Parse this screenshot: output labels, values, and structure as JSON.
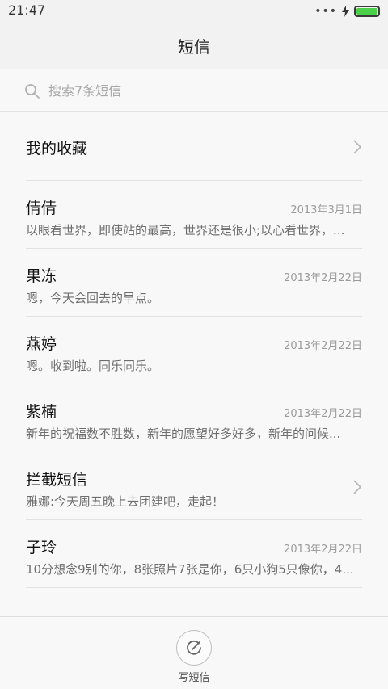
{
  "status": {
    "time": "21:47",
    "signal": "•••",
    "battery_level": 1.0,
    "battery_color": "#4cd04a"
  },
  "header": {
    "title": "短信"
  },
  "search": {
    "placeholder": "搜索7条短信"
  },
  "favorites": {
    "label": "我的收藏"
  },
  "conversations": [
    {
      "name": "倩倩",
      "date": "2013年3月1日",
      "preview": "以眼看世界，即使站的最高，世界还是很小;以心看世界，..."
    },
    {
      "name": "果冻",
      "date": "2013年2月22日",
      "preview": "嗯，今天会回去的早点。"
    },
    {
      "name": "燕婷",
      "date": "2013年2月22日",
      "preview": "嗯。收到啦。同乐同乐。"
    },
    {
      "name": "紫楠",
      "date": "2013年2月22日",
      "preview": "新年的祝福数不胜数，新年的愿望好多好多，新年的问候..."
    },
    {
      "name": "拦截短信",
      "date": "",
      "preview": "雅娜:今天周五晚上去团建吧，走起！"
    },
    {
      "name": "子玲",
      "date": "2013年2月22日",
      "preview": "10分想念9别的你，8张照片7张是你，6只小狗5只像你，4..."
    }
  ],
  "bottom": {
    "compose_label": "写短信"
  }
}
